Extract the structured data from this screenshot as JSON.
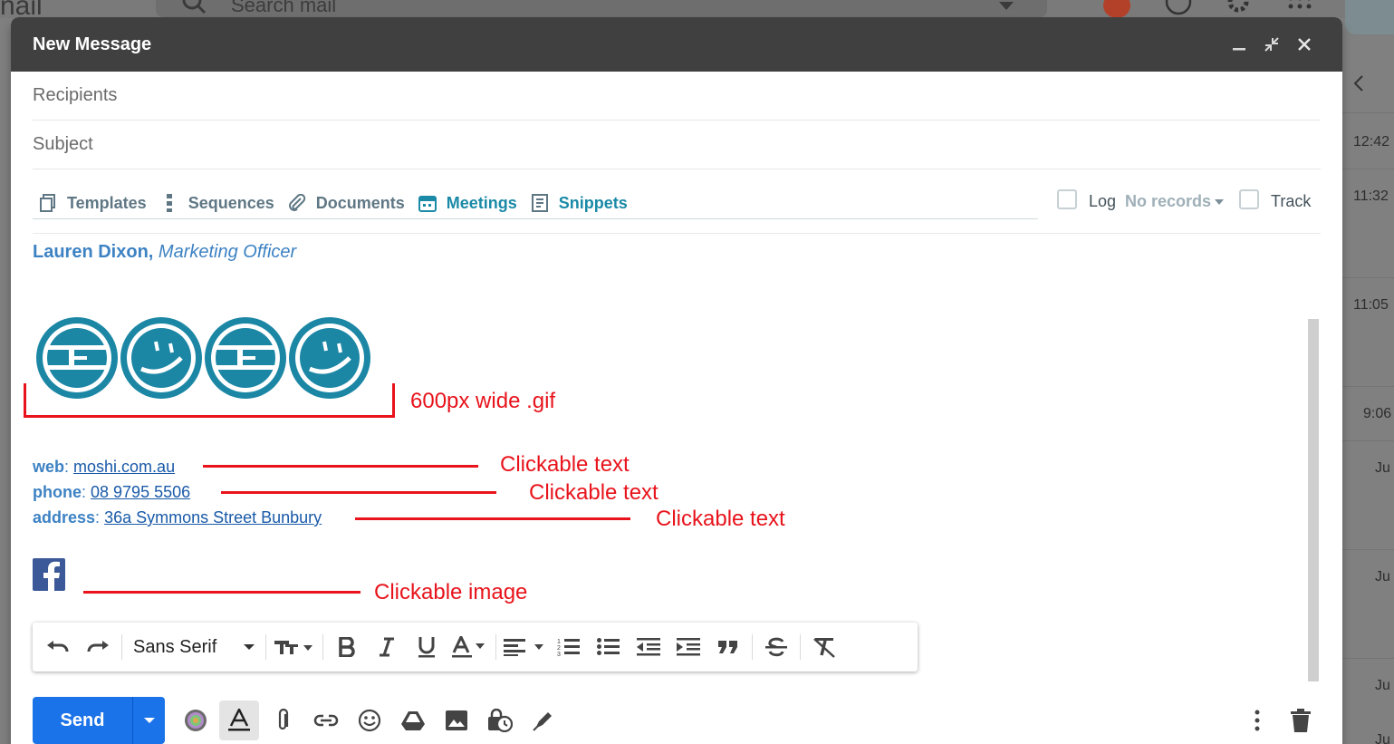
{
  "background": {
    "logo_partial": "nail",
    "search_placeholder": "Search mail",
    "times": [
      "12:42",
      "11:32",
      "11:05",
      "9:06",
      "Ju",
      "Ju",
      "Ju",
      "Ju"
    ]
  },
  "compose": {
    "title": "New Message",
    "recipients_placeholder": "Recipients",
    "subject_placeholder": "Subject",
    "toolbar": {
      "templates": "Templates",
      "sequences": "Sequences",
      "documents": "Documents",
      "meetings": "Meetings",
      "snippets": "Snippets",
      "log_label": "Log",
      "log_value": "No records",
      "track_label": "Track"
    },
    "signature": {
      "name": "Lauren Dixon,",
      "role": "Marketing Officer",
      "web_label": "web",
      "web_value": "moshi.com.au",
      "phone_label": "phone",
      "phone_value": "08 9795 5506",
      "address_label": "address",
      "address_value": "36a Symmons Street Bunbury"
    },
    "annotations": {
      "gif": "600px wide .gif",
      "web": "Clickable text",
      "phone": "Clickable text",
      "address": "Clickable text",
      "facebook": "Clickable image"
    },
    "format_bar": {
      "font": "Sans Serif"
    },
    "send_label": "Send"
  },
  "colors": {
    "header": "#404040",
    "accent_blue": "#1a73e8",
    "signature_blue": "#3d82c3",
    "annotation_red": "#e8131b",
    "logo_teal": "#1c87a5"
  }
}
